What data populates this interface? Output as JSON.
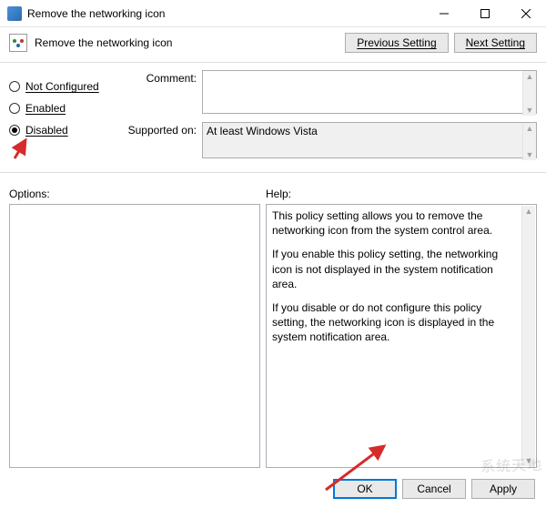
{
  "window": {
    "title": "Remove the networking icon",
    "minimize_label": "Minimize",
    "maximize_label": "Maximize",
    "close_label": "Close"
  },
  "header": {
    "title": "Remove the networking icon",
    "previous_label": "Previous Setting",
    "next_label": "Next Setting"
  },
  "radios": {
    "not_configured": "Not Configured",
    "enabled": "Enabled",
    "disabled": "Disabled",
    "selected": "disabled"
  },
  "fields": {
    "comment_label": "Comment:",
    "comment_value": "",
    "supported_label": "Supported on:",
    "supported_value": "At least Windows Vista"
  },
  "labels": {
    "options": "Options:",
    "help": "Help:"
  },
  "help": {
    "p1": "This policy setting allows you to remove the networking icon from the system control area.",
    "p2": "If you enable this policy setting, the networking icon is not displayed in the system notification area.",
    "p3": "If you disable or do not configure this policy setting, the networking icon is displayed in the system notification area."
  },
  "buttons": {
    "ok": "OK",
    "cancel": "Cancel",
    "apply": "Apply"
  },
  "watermark": "系统天地"
}
